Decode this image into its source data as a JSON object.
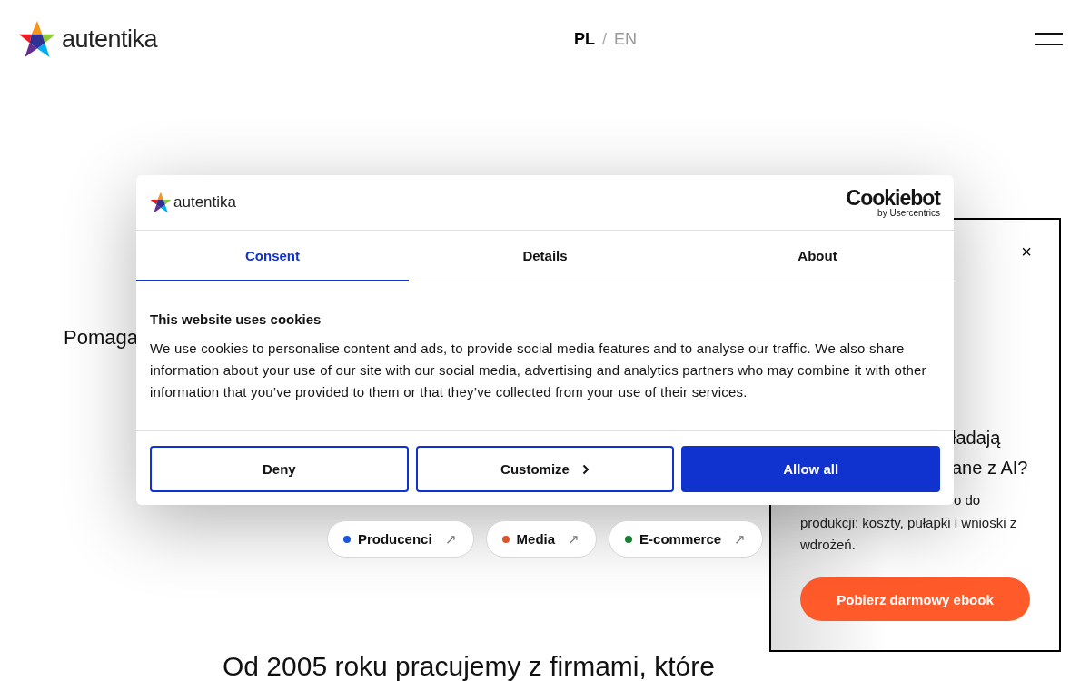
{
  "header": {
    "logo_text": "autentika",
    "languages": [
      {
        "label": "PL",
        "selected": true
      },
      {
        "label": "EN",
        "selected": false
      }
    ],
    "language_separator": "/"
  },
  "hero": {
    "lead": "Pomaga",
    "sectors": [
      {
        "label": "Producenci",
        "color": "#1a56db",
        "arrow": "↗"
      },
      {
        "label": "Media",
        "color": "#e0522b",
        "arrow": "↗"
      },
      {
        "label": "E-commerce",
        "color": "#16802e",
        "arrow": "↗"
      }
    ],
    "next_heading": "Od 2005 roku pracujemy z firmami, które"
  },
  "promo": {
    "close": "×",
    "title_lines": [
      "ładają",
      "ane z AI?"
    ],
    "text_fragment": "o do",
    "text": "produkcji: koszty, pułapki i wnioski z wdrożeń.",
    "button": "Pobierz darmowy ebook"
  },
  "cookie_dialog": {
    "logo_text": "autentika",
    "brand": "Cookiebot",
    "brand_sub": "by Usercentrics",
    "tabs": [
      {
        "label": "Consent",
        "selected": true
      },
      {
        "label": "Details",
        "selected": false
      },
      {
        "label": "About",
        "selected": false
      }
    ],
    "title": "This website uses cookies",
    "text": "We use cookies to personalise content and ads, to provide social media features and to analyse our traffic. We also share information about your use of our site with our social media, advertising and analytics partners who may combine it with other information that you’ve provided to them or that they’ve collected from your use of their services.",
    "buttons": [
      {
        "label": "Deny",
        "kind": "outline",
        "chevron": false
      },
      {
        "label": "Customize",
        "kind": "outline",
        "chevron": true
      },
      {
        "label": "Allow all",
        "kind": "primary",
        "chevron": false
      }
    ]
  }
}
